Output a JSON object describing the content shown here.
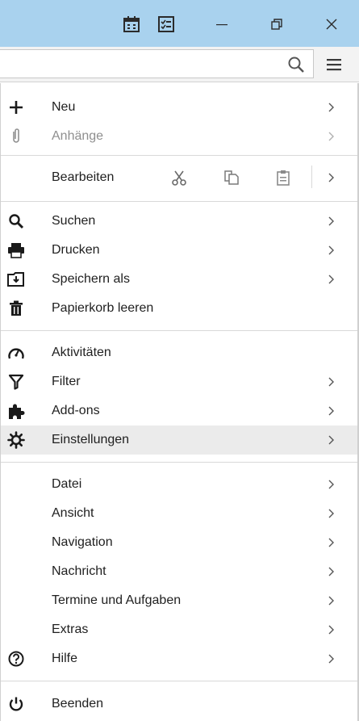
{
  "titlebar": {
    "buttons": [
      "calendar-icon",
      "tasks-icon",
      "minimize-icon",
      "restore-icon",
      "close-icon"
    ]
  },
  "toolbar": {
    "search_placeholder": "",
    "menu_icon": "hamburger-icon"
  },
  "menu": {
    "neu": "Neu",
    "anhaenge": "Anhänge",
    "bearbeiten": "Bearbeiten",
    "suchen": "Suchen",
    "drucken": "Drucken",
    "speichern_als": "Speichern als",
    "papierkorb": "Papierkorb leeren",
    "aktivitaeten": "Aktivitäten",
    "filter": "Filter",
    "addons": "Add-ons",
    "einstellungen": "Einstellungen",
    "datei": "Datei",
    "ansicht": "Ansicht",
    "navigation": "Navigation",
    "nachricht": "Nachricht",
    "termine": "Termine und Aufgaben",
    "extras": "Extras",
    "hilfe": "Hilfe",
    "beenden": "Beenden"
  },
  "colors": {
    "titlebar": "#a9d2ee",
    "hover": "#ebebeb",
    "disabled_text": "#8f8f8f"
  }
}
